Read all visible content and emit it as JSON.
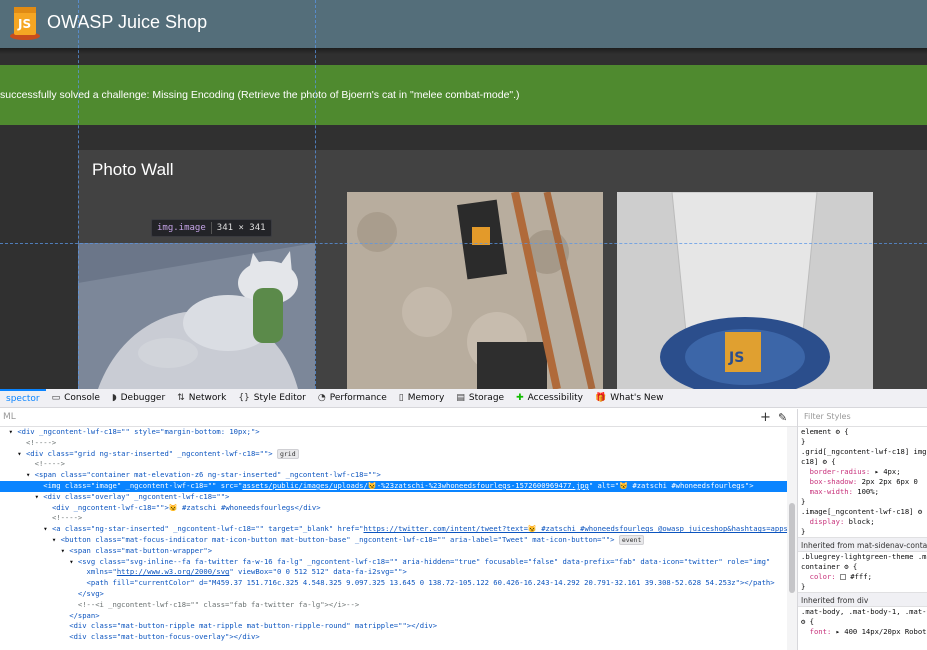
{
  "app": {
    "title": "OWASP Juice Shop",
    "banner": "successfully solved a challenge: Missing Encoding (Retrieve the photo of Bjoern's cat in \"melee combat-mode\".)",
    "card_title": "Photo Wall",
    "tooltip": {
      "tag": "img.image",
      "dims": "341 × 341"
    },
    "colors": {
      "toolbar": "#546e7a",
      "banner": "#4f8a2f",
      "card": "#424242",
      "background": "#303030"
    }
  },
  "devtools": {
    "tabs": [
      {
        "label": "spector",
        "icon": "inspector-icon"
      },
      {
        "label": "Console",
        "icon": "console-icon"
      },
      {
        "label": "Debugger",
        "icon": "debugger-icon"
      },
      {
        "label": "Network",
        "icon": "network-icon"
      },
      {
        "label": "Style Editor",
        "icon": "style-editor-icon"
      },
      {
        "label": "Performance",
        "icon": "performance-icon"
      },
      {
        "label": "Memory",
        "icon": "memory-icon"
      },
      {
        "label": "Storage",
        "icon": "storage-icon"
      },
      {
        "label": "Accessibility",
        "icon": "accessibility-icon"
      },
      {
        "label": "What's New",
        "icon": "whats-new-icon"
      }
    ],
    "search_label": "ML",
    "rules_filter_placeholder": "Filter Styles",
    "dom": {
      "l0": "<div _ngcontent-lwf-c18=\"\" style=\"margin-bottom: 10px;\">",
      "l1": "<!---->",
      "l2": "<div class=\"grid ng-star-inserted\" _ngcontent-lwf-c18=\"\">",
      "l2_badge": "grid",
      "l3": "<!---->",
      "l4": "<span class=\"container mat-elevation-z6 ng-star-inserted\" _ngcontent-lwf-c18=\"\">",
      "l5a": "<img class=\"image\" _ngcontent-lwf-c18=\"\" src=\"",
      "l5b": "assets/public/images/uploads/😼-%23zatschi-%23whoneedsfourlegs-1572600969477.jpg",
      "l5c": "\" alt=\"😼 #zatschi #whoneedsfourlegs\">",
      "l6": "<div class=\"overlay\" _ngcontent-lwf-c18=\"\">",
      "l7": "<div _ngcontent-lwf-c18=\"\">😼 #zatschi #whoneedsfourlegs</div>",
      "l8": "<!---->",
      "l9a": "<a class=\"ng-star-inserted\" _ngcontent-lwf-c18=\"\" target=\"_blank\" href=\"",
      "l9b": "https://twitter.com/intent/tweet?text=😼 #zatschi #whoneedsfourlegs @owasp_juiceshop&hashtags=appsec",
      "l9c": "\">",
      "l10": "<button class=\"mat-focus-indicator mat-icon-button mat-button-base\" _ngcontent-lwf-c18=\"\" aria-label=\"Tweet\" mat-icon-button=\"\">",
      "l10_badge": "event",
      "l11": "<span class=\"mat-button-wrapper\">",
      "l12": "<svg class=\"svg-inline--fa fa-twitter fa-w-16 fa-lg\" _ngcontent-lwf-c18=\"\" aria-hidden=\"true\" focusable=\"false\" data-prefix=\"fab\" data-icon=\"twitter\" role=\"img\"",
      "l13a": "xmlns=\"",
      "l13b": "http://www.w3.org/2000/svg",
      "l13c": "\" viewBox=\"0 0 512 512\" data-fa-i2svg=\"\">",
      "l14": "<path fill=\"currentColor\" d=\"M459.37 151.716c.325 4.548.325 9.097.325 13.645 0 138.72-105.122 60.426-16.243-14.292 20.791-32.161 39.308-52.628 54.253z\"></path>",
      "l15": "</svg>",
      "l16": "<!--<i _ngcontent-lwf-c18=\"\" class=\"fab fa-twitter fa-lg\"></i>-->",
      "l17": "</span>",
      "l18": "<div class=\"mat-button-ripple mat-ripple mat-button-ripple-round\" matripple=\"\"></div>",
      "l19": "<div class=\"mat-button-focus-overlay\"></div>"
    },
    "rules": {
      "r0": "element ⚙ {",
      "r1": "}",
      "r2": ".grid[_ngcontent-lwf-c18] img[_",
      "r3": "c18] ⚙ {",
      "r4_prop": "border-radius:",
      "r4_val": " ▸ 4px;",
      "r5_prop": "box-shadow:",
      "r5_val": " 2px 2px 6px 0",
      "r6_prop": "max-width:",
      "r6_val": " 100%;",
      "r7": "}",
      "r8": ".image[_ngcontent-lwf-c18] ⚙",
      "r9_prop": "display:",
      "r9_val": " block;",
      "r10": "}",
      "head1": "Inherited from mat-sidenav-contai",
      "r11": ".bluegrey-lightgreen-theme .ma",
      "r12": "container ⚙ {",
      "r13_prop": "color:",
      "r13_val": " #fff;",
      "r14": "}",
      "head2": "Inherited from div",
      "r15": ".mat-body, .mat-body-1, .mat-ty",
      "r16": "⚙ {",
      "r17_prop": "font:",
      "r17_val": " ▸ 400 14px/20px Roboto"
    }
  }
}
